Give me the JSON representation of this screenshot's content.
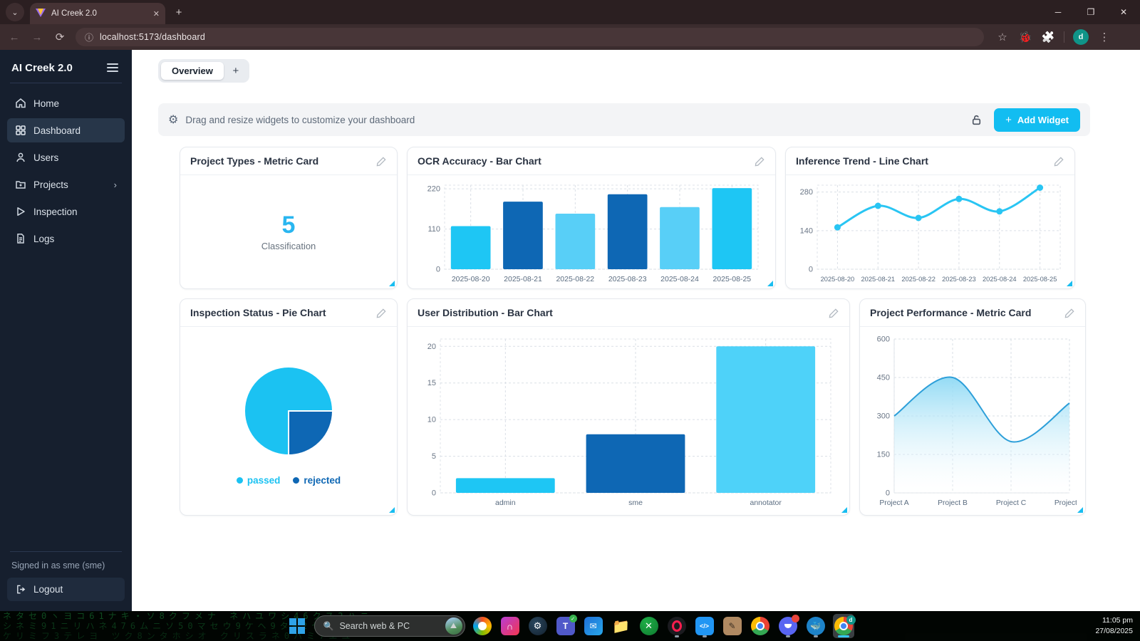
{
  "browser": {
    "tab_title": "AI Creek 2.0",
    "url": "localhost:5173/dashboard",
    "profile_initial": "d"
  },
  "sidebar": {
    "title": "AI Creek 2.0",
    "items": [
      {
        "label": "Home"
      },
      {
        "label": "Dashboard"
      },
      {
        "label": "Users"
      },
      {
        "label": "Projects"
      },
      {
        "label": "Inspection"
      },
      {
        "label": "Logs"
      }
    ],
    "signed_in": "Signed in as sme (sme)",
    "logout_label": "Logout"
  },
  "page_tabs": {
    "active": "Overview",
    "add": "+"
  },
  "toolbar": {
    "hint": "Drag and resize widgets to customize your dashboard",
    "add_widget_label": "Add Widget",
    "accent_color": "#12bdf1"
  },
  "chart_data": [
    {
      "type": "metric",
      "title": "Project Types - Metric Card",
      "value": 5,
      "label": "Classification",
      "accent": "#29b6f0"
    },
    {
      "type": "bar",
      "title": "OCR Accuracy - Bar Chart",
      "categories": [
        "2025-08-20",
        "2025-08-21",
        "2025-08-22",
        "2025-08-23",
        "2025-08-24",
        "2025-08-25"
      ],
      "values": [
        118,
        185,
        152,
        205,
        170,
        222
      ],
      "bar_colors": [
        "#1ec6f4",
        "#0e67b4",
        "#58cff7",
        "#0e67b4",
        "#58cff7",
        "#1ec6f4"
      ],
      "yticks": [
        0,
        110,
        220
      ],
      "ylim": [
        0,
        230
      ],
      "grid": true,
      "xlabel": "",
      "ylabel": ""
    },
    {
      "type": "line",
      "title": "Inference Trend - Line Chart",
      "categories": [
        "2025-08-20",
        "2025-08-21",
        "2025-08-22",
        "2025-08-23",
        "2025-08-24",
        "2025-08-25"
      ],
      "values": [
        152,
        230,
        186,
        255,
        210,
        296
      ],
      "color": "#29c5f3",
      "yticks": [
        0,
        140,
        280
      ],
      "ylim": [
        0,
        305
      ],
      "grid": true,
      "xlabel": "",
      "ylabel": ""
    },
    {
      "type": "pie",
      "title": "Inspection Status - Pie Chart",
      "slices": [
        {
          "label": "passed",
          "value": 75,
          "color": "#1bc2f2"
        },
        {
          "label": "rejected",
          "value": 25,
          "color": "#0e67b4"
        }
      ],
      "legend_position": "bottom"
    },
    {
      "type": "bar",
      "title": "User Distribution - Bar Chart",
      "categories": [
        "admin",
        "sme",
        "annotator"
      ],
      "values": [
        2,
        8,
        20
      ],
      "bar_colors": [
        "#1ec6f4",
        "#0e67b4",
        "#4ed2f9"
      ],
      "yticks": [
        0,
        5,
        10,
        15,
        20
      ],
      "ylim": [
        0,
        21
      ],
      "grid": true,
      "xlabel": "",
      "ylabel": ""
    },
    {
      "type": "area",
      "title": "Project Performance - Metric Card",
      "categories": [
        "Project A",
        "Project B",
        "Project C",
        "Project D"
      ],
      "values": [
        300,
        450,
        200,
        350
      ],
      "color": "#2d9fd9",
      "fill_top": "#8ed9f4",
      "yticks": [
        0,
        150,
        300,
        450,
        600
      ],
      "ylim": [
        0,
        600
      ],
      "grid": true,
      "xlabel": "",
      "ylabel": ""
    }
  ],
  "taskbar": {
    "search_placeholder": "Search web & PC",
    "time": "11:05 pm",
    "date": "27/08/2025"
  },
  "wallpaper_rows": [
    "ネタセ0ヽヨコ61ナキ・ソ8クフメナ ネハユワシ46クス2ハニ",
    "シネミ91ニリハネ476ムニソ50マセウ9ケヘ9タ─2セニオ",
    "ケリミフ3テレヨ ツク8ンタホシオ クリスラネ0ハミ7エユ"
  ]
}
